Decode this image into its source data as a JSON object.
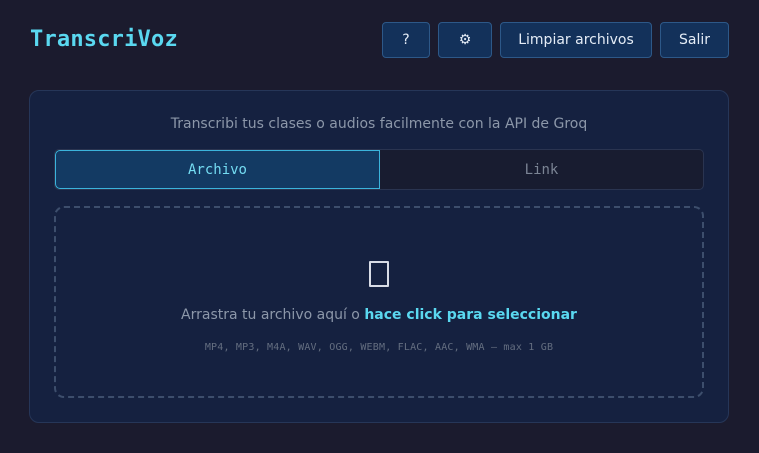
{
  "app": {
    "title": "TranscriVoz"
  },
  "header": {
    "help_label": "?",
    "settings_label": "⚙",
    "clear_label": "Limpiar archivos",
    "logout_label": "Salir"
  },
  "main": {
    "tagline": "Transcribi tus clases o audios facilmente con la API de Groq",
    "tabs": [
      {
        "label": "Archivo",
        "active": true
      },
      {
        "label": "Link",
        "active": false
      }
    ],
    "dropzone": {
      "icon": "file-icon",
      "text_prefix": "Arrastra tu archivo aquí o ",
      "link_text": "hace click para seleccionar",
      "formats": "MP4, MP3, M4A, WAV, OGG, WEBM, FLAC, AAC, WMA — max 1 GB"
    }
  },
  "colors": {
    "background": "#1b1b2e",
    "accent": "#5ad8f0",
    "button_bg": "#13315a",
    "card_bg": "#152140"
  }
}
